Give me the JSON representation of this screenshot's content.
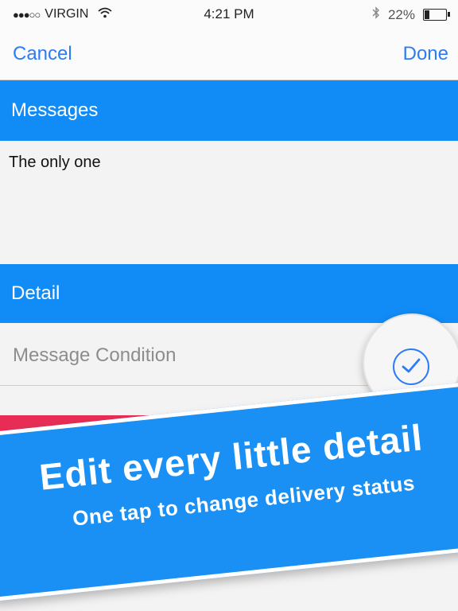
{
  "status_bar": {
    "signal_dots": "●●●○○",
    "carrier": "VIRGIN",
    "wifi_icon": "wifi-icon",
    "time": "4:21 PM",
    "bluetooth_icon": "bluetooth-icon",
    "battery_percent": "22%",
    "battery_level": 0.22
  },
  "nav": {
    "cancel_label": "Cancel",
    "done_label": "Done"
  },
  "messages_section": {
    "header": "Messages",
    "message_text": "The only one"
  },
  "detail_section": {
    "header": "Detail",
    "condition_label": "Message Condition",
    "check_icon": "checkmark-icon"
  },
  "banner": {
    "title": "Edit every little detail",
    "subtitle": "One tap to change delivery status"
  },
  "colors": {
    "accent_blue": "#118bf5",
    "nav_blue": "#2d7cf6",
    "red_strip": "#e72d55"
  }
}
